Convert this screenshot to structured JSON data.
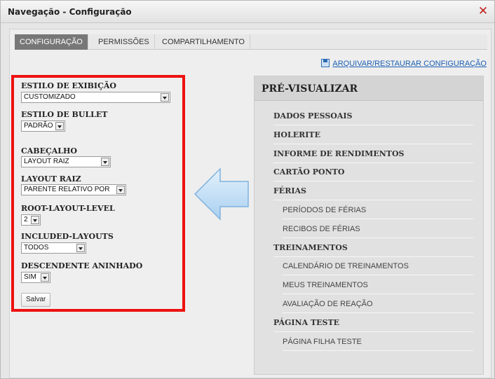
{
  "window": {
    "title": "Navegação - Configuração",
    "close_symbol": "✕"
  },
  "tabs": [
    {
      "label": "CONFIGURAÇÃO",
      "active": true
    },
    {
      "label": "PERMISSÕES",
      "active": false
    },
    {
      "label": "COMPARTILHAMENTO",
      "active": false
    }
  ],
  "archive_link": "ARQUIVAR/RESTAURAR CONFIGURAÇÃO",
  "form": {
    "display_style": {
      "label": "ESTILO DE EXIBIÇÃO",
      "value": "CUSTOMIZADO"
    },
    "bullet_style": {
      "label": "ESTILO DE BULLET",
      "value": "PADRÃO"
    },
    "header": {
      "label": "CABEÇALHO",
      "value": "LAYOUT RAIZ"
    },
    "root_layout": {
      "label": "LAYOUT RAIZ",
      "value": "PARENTE RELATIVO POR"
    },
    "root_layout_level": {
      "label": "ROOT-LAYOUT-LEVEL",
      "value": "2"
    },
    "included_layouts": {
      "label": "INCLUDED-LAYOUTS",
      "value": "TODOS"
    },
    "nested_descendant": {
      "label": "DESCENDENTE ANINHADO",
      "value": "SIM"
    },
    "save_label": "Salvar"
  },
  "preview": {
    "title": "PRÉ-VISUALIZAR",
    "items": [
      {
        "label": "DADOS PESSOAIS",
        "level": 0
      },
      {
        "label": "HOLERITE",
        "level": 0
      },
      {
        "label": "INFORME DE RENDIMENTOS",
        "level": 0
      },
      {
        "label": "CARTÃO PONTO",
        "level": 0
      },
      {
        "label": "FÉRIAS",
        "level": 0
      },
      {
        "label": "PERÍODOS DE FÉRIAS",
        "level": 1
      },
      {
        "label": "RECIBOS DE FÉRIAS",
        "level": 1
      },
      {
        "label": "TREINAMENTOS",
        "level": 0
      },
      {
        "label": "CALENDÁRIO DE TREINAMENTOS",
        "level": 1
      },
      {
        "label": "MEUS TREINAMENTOS",
        "level": 1
      },
      {
        "label": "AVALIAÇÃO DE REAÇÃO",
        "level": 1
      },
      {
        "label": "PÁGINA TESTE",
        "level": 0
      },
      {
        "label": "PÁGINA FILHA TESTE",
        "level": 1
      }
    ]
  },
  "colors": {
    "highlight_border": "#ee1111",
    "active_tab": "#777777",
    "link": "#1a5fb4",
    "arrow_fill": "#bcdcf5"
  },
  "icons": {
    "close": "close-icon",
    "save": "floppy-icon",
    "direction": "left-arrow-icon"
  }
}
